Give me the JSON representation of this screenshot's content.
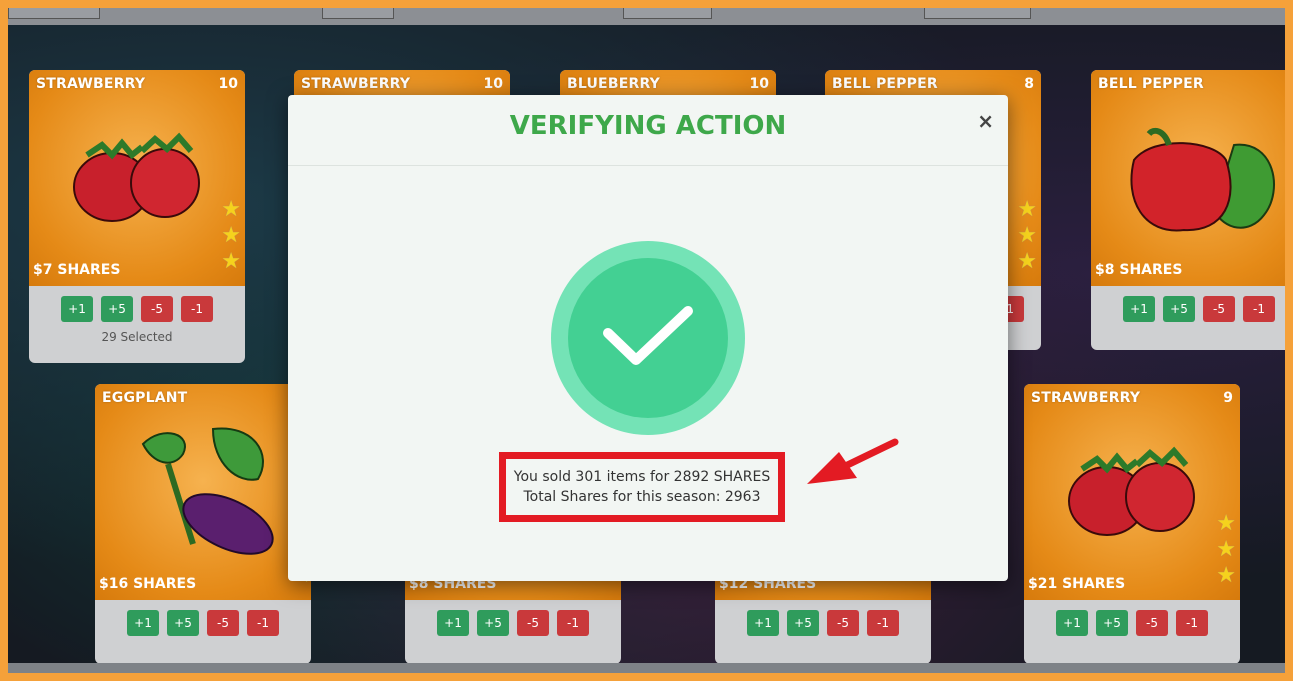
{
  "modal": {
    "title": "VERIFYING ACTION",
    "close_label": "×",
    "sold_message": "You sold 301 items for 2892 SHARES",
    "total_message": "Total Shares for this season: 2963"
  },
  "buttons": {
    "plus1": "+1",
    "plus5": "+5",
    "minus5": "-5",
    "minus1": "-1"
  },
  "cards": [
    {
      "name": "STRAWBERRY",
      "count": "10",
      "price": "$7 SHARES",
      "selected": "29 Selected"
    },
    {
      "name": "STRAWBERRY",
      "count": "10",
      "price": "",
      "selected": ""
    },
    {
      "name": "BLUEBERRY",
      "count": "10",
      "price": "",
      "selected": ""
    },
    {
      "name": "BELL PEPPER",
      "count": "8",
      "price": "",
      "selected": ""
    },
    {
      "name": "BELL PEPPER",
      "count": "",
      "price": "$8 SHARES",
      "selected": ""
    },
    {
      "name": "EGGPLANT",
      "count": "",
      "price": "$16 SHARES",
      "selected": ""
    },
    {
      "name": "",
      "count": "",
      "price": "$8 SHARES",
      "selected": ""
    },
    {
      "name": "",
      "count": "",
      "price": "$12 SHARES",
      "selected": ""
    },
    {
      "name": "STRAWBERRY",
      "count": "9",
      "price": "$21 SHARES",
      "selected": ""
    }
  ],
  "colors": {
    "accent_green": "#3ea84a",
    "check_green": "#43d093",
    "highlight_red": "#e31b23",
    "frame_orange": "#f5a13a"
  }
}
